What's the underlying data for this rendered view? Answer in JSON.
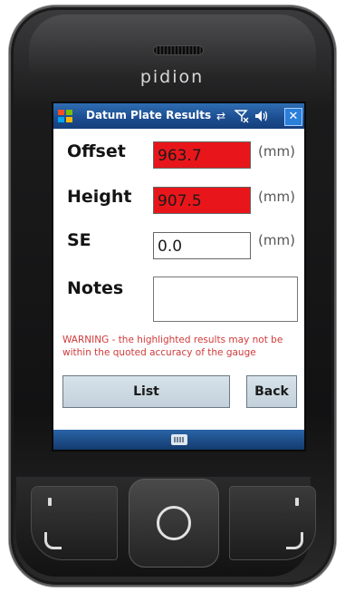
{
  "device": {
    "brand": "pidion"
  },
  "titlebar": {
    "title": "Datum Plate Results",
    "close_label": "✕"
  },
  "fields": {
    "offset": {
      "label": "Offset",
      "value": "963.7",
      "unit": "(mm)",
      "highlighted": true
    },
    "height": {
      "label": "Height",
      "value": "907.5",
      "unit": "(mm)",
      "highlighted": true
    },
    "se": {
      "label": "SE",
      "value": "0.0",
      "unit": "(mm)",
      "highlighted": false
    },
    "notes": {
      "label": "Notes",
      "value": ""
    }
  },
  "warning": "WARNING - the highlighted  results may not be within the quoted accuracy of the gauge",
  "buttons": {
    "list": "List",
    "back": "Back"
  },
  "colors": {
    "highlight": "#e8161a",
    "warning_text": "#d03a3a",
    "titlebar": "#1d4e92"
  },
  "icons": {
    "start": "windows-flag-icon",
    "connectivity": "sync-arrows-icon",
    "signal": "no-signal-icon",
    "volume": "speaker-icon",
    "keyboard": "keyboard-icon",
    "home": "home-ring-icon"
  }
}
